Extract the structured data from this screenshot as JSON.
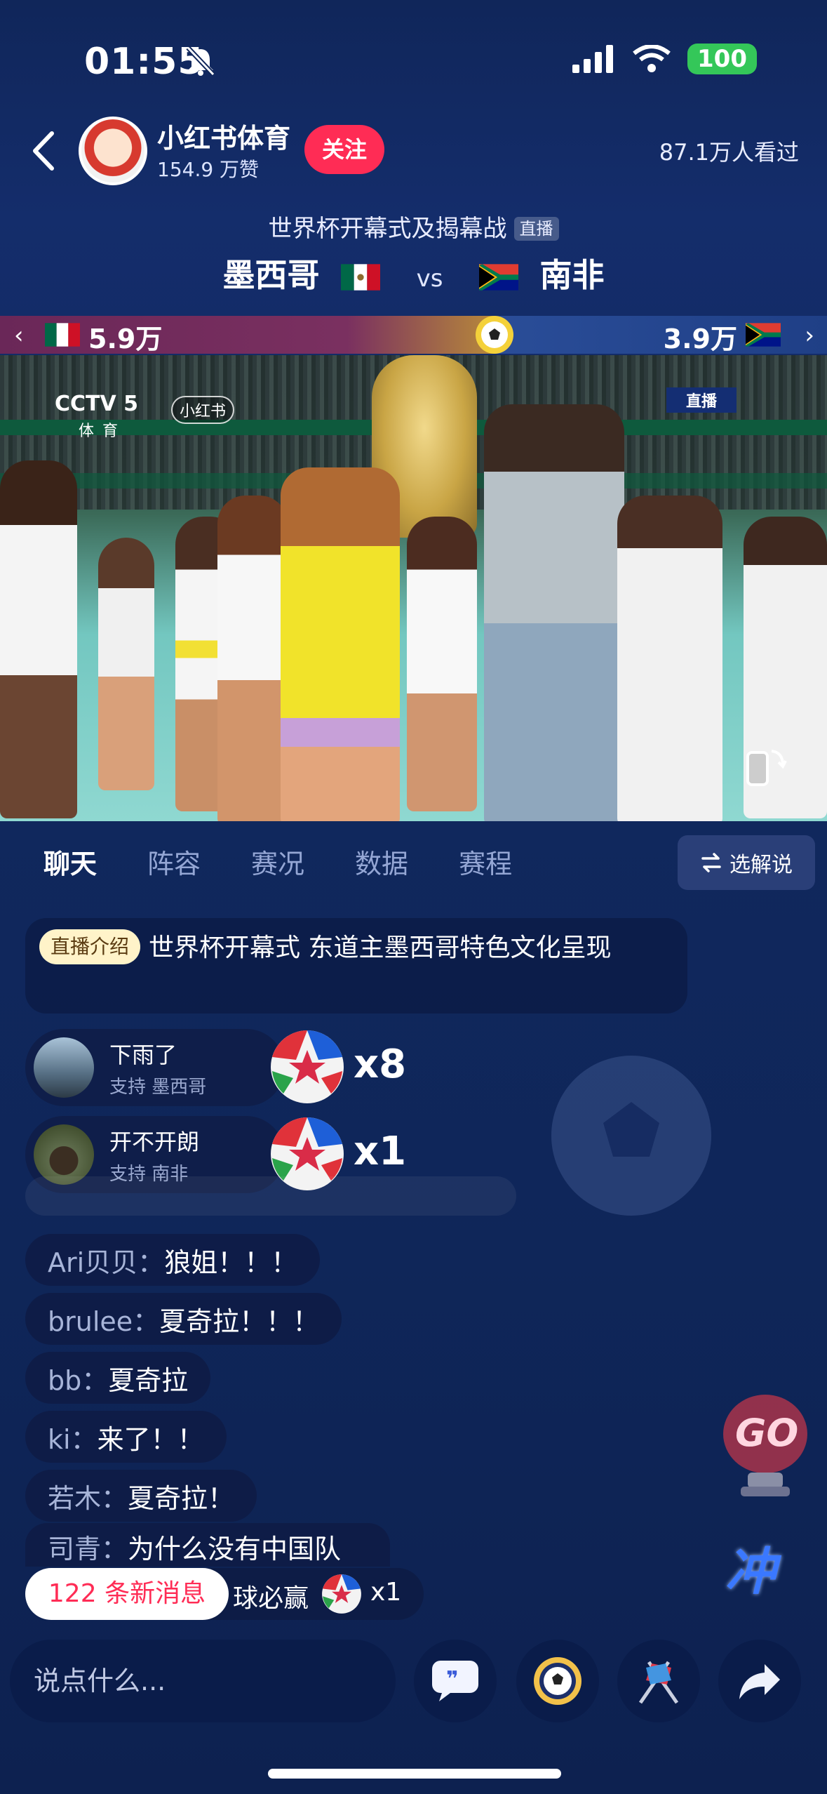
{
  "status_bar": {
    "time": "01:55",
    "battery": "100"
  },
  "header": {
    "channel_name": "小红书体育",
    "likes": "154.9 万赞",
    "follow_label": "关注",
    "viewers": "87.1万人看过"
  },
  "event": {
    "title": "世界杯开幕式及揭幕战",
    "live_tag": "直播",
    "home_team": "墨西哥",
    "vs": "vs",
    "away_team": "南非"
  },
  "support": {
    "home_value": "5.9万",
    "away_value": "3.9万"
  },
  "video": {
    "broadcaster_logo": "CCTV 5",
    "broadcaster_sub": "体育",
    "watermark": "小红书",
    "live_label": "直播"
  },
  "tabs": [
    "聊天",
    "阵容",
    "赛况",
    "数据",
    "赛程"
  ],
  "commentator_label": "选解说",
  "intro": {
    "tag": "直播介绍",
    "text": "世界杯开幕式 东道主墨西哥特色文化呈现"
  },
  "gifts": [
    {
      "name": "下雨了",
      "support": "支持 墨西哥",
      "count": "x8"
    },
    {
      "name": "开不开朗",
      "support": "支持 南非",
      "count": "x1"
    }
  ],
  "chat": [
    {
      "user": "Ari贝贝：",
      "text": "狼姐！！！"
    },
    {
      "user": "brulee：",
      "text": "夏奇拉！！！"
    },
    {
      "user": "bb：",
      "text": "夏奇拉"
    },
    {
      "user": "ki：",
      "text": "来了！！"
    },
    {
      "user": "若木：",
      "text": "夏奇拉！"
    },
    {
      "user": "司青：",
      "text": "为什么没有中国队"
    }
  ],
  "bottom_pill": {
    "new_messages": "122 条新消息",
    "text": "球必赢",
    "count": "x1"
  },
  "deco": {
    "chong": "冲"
  },
  "input": {
    "placeholder": "说点什么..."
  },
  "colors": {
    "follow": "#ff2c55",
    "battery": "#34c759",
    "bg": "#142d6b"
  }
}
